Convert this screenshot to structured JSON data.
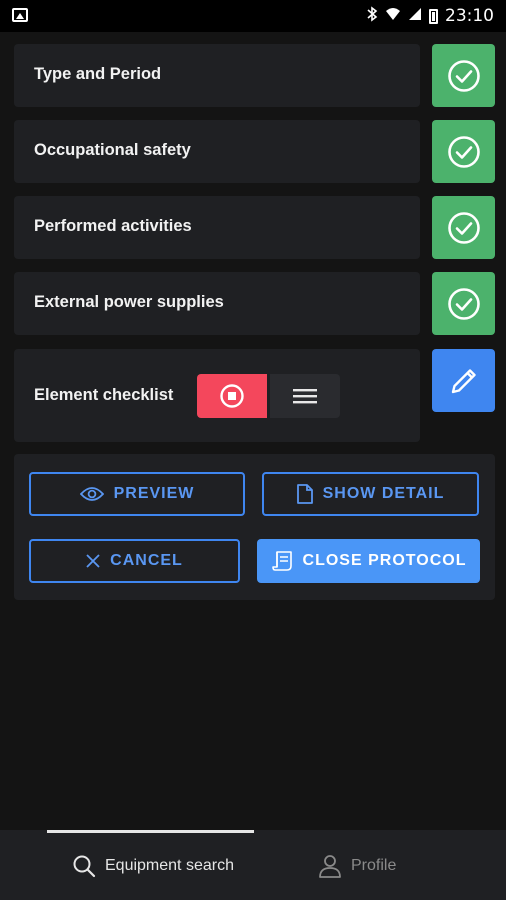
{
  "status_bar": {
    "time": "23:10",
    "icons": [
      "image-icon",
      "bluetooth-icon",
      "wifi-icon",
      "signal-icon",
      "battery-icon"
    ]
  },
  "sections": [
    {
      "label": "Type and Period",
      "status": "done",
      "icon": "check-circle-icon"
    },
    {
      "label": "Occupational safety",
      "status": "done",
      "icon": "check-circle-icon"
    },
    {
      "label": "Performed activities",
      "status": "done",
      "icon": "check-circle-icon"
    },
    {
      "label": "External power supplies",
      "status": "done",
      "icon": "check-circle-icon"
    },
    {
      "label": "Element checklist",
      "status": "edit",
      "icon": "pencil-icon"
    }
  ],
  "checklist_toggle": {
    "left_icon": "stop-circle-icon",
    "right_icon": "menu-lines-icon"
  },
  "actions": {
    "preview": "PREVIEW",
    "show_detail": "SHOW DETAIL",
    "cancel": "CANCEL",
    "close_protocol": "CLOSE PROTOCOL"
  },
  "bottom_nav": {
    "items": [
      {
        "label": "Equipment search",
        "icon": "search-icon",
        "active": true
      },
      {
        "label": "Profile",
        "icon": "person-icon",
        "active": false
      }
    ]
  },
  "colors": {
    "background": "#141414",
    "card": "#1f2023",
    "done": "#4cb26c",
    "edit": "#3f86f0",
    "accent": "#4a96f7",
    "stop_red": "#f4475c"
  }
}
